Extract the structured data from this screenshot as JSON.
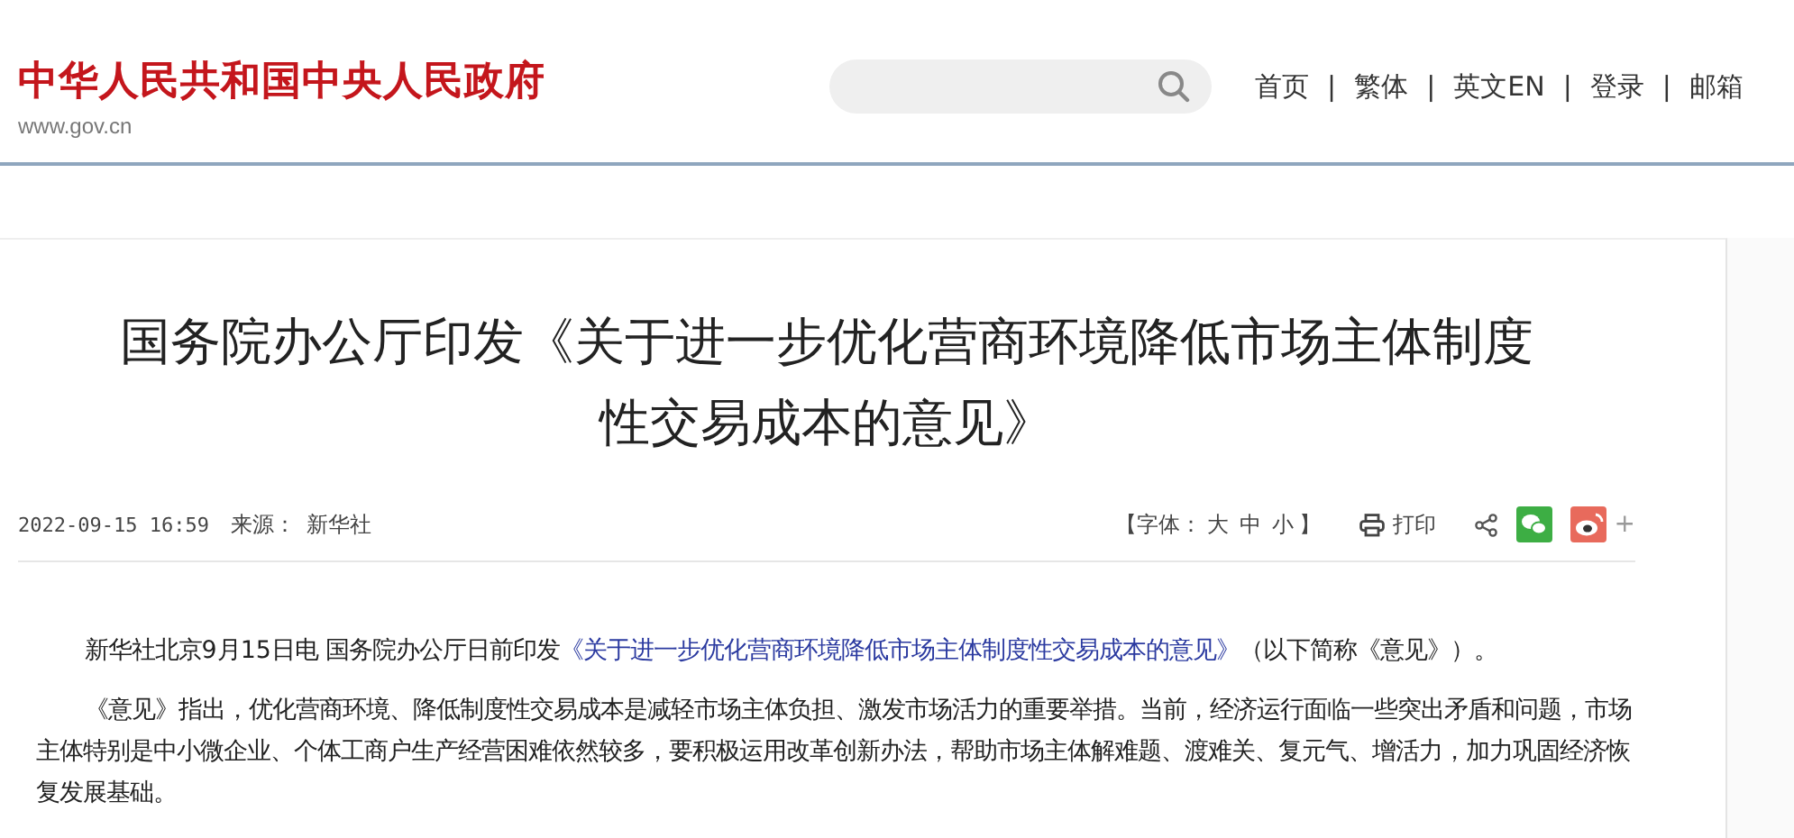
{
  "header": {
    "site_name": "中华人民共和国中央人民政府",
    "domain": "www.gov.cn",
    "nav": [
      "首页",
      "繁体",
      "英文EN",
      "登录",
      "邮箱"
    ],
    "separator": "|"
  },
  "article": {
    "title": "国务院办公厅印发《关于进一步优化营商环境降低市场主体制度性交易成本的意见》",
    "date": "2022-09-15 16:59",
    "source_label": "来源：",
    "source": "新华社",
    "font_size": {
      "open": "【字体：",
      "options": [
        "大",
        "中",
        "小"
      ],
      "close": "】"
    },
    "print": "打印",
    "more": "+",
    "paragraphs": [
      {
        "before": "新华社北京9月15日电 国务院办公厅日前印发",
        "link": "《关于进一步优化营商环境降低市场主体制度性交易成本的意见》",
        "after": "（以下简称《意见》）。"
      },
      {
        "before": "《意见》指出，优化营商环境、降低制度性交易成本是减轻市场主体负担、激发市场活力的重要举措。当前，经济运行面临一些突出矛盾和问题，市场主体特别是中小微企业、个体工商户生产经营困难依然较多，要积极运用改革创新办法，帮助市场主体解难题、渡难关、复元气、增活力，加力巩固经济恢复发展基础。"
      }
    ]
  }
}
